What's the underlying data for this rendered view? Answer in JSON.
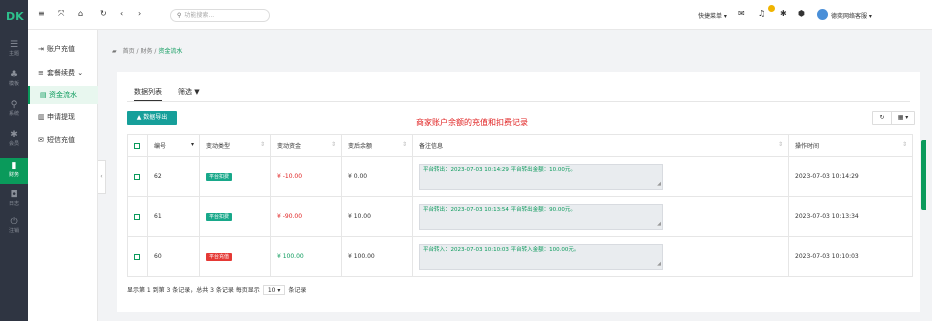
{
  "logo": "DK",
  "iconbar": [
    {
      "icon": "menu-icon",
      "glyph": "☰",
      "label": "主题"
    },
    {
      "icon": "org-icon",
      "glyph": "♣",
      "label": "模板"
    },
    {
      "icon": "location-icon",
      "glyph": "⚲",
      "label": "系统"
    },
    {
      "icon": "tag-icon",
      "glyph": "✱",
      "label": "会员"
    },
    {
      "icon": "finance-icon",
      "glyph": "▮",
      "label": "财务"
    },
    {
      "icon": "shield-icon",
      "glyph": "◘",
      "label": "日志"
    },
    {
      "icon": "power-icon",
      "glyph": "⏻",
      "label": "注销"
    }
  ],
  "submenu": [
    {
      "glyph": "⇥",
      "label": "账户充值"
    },
    {
      "glyph": "≡",
      "label": "套餐续费 ⌄"
    },
    {
      "glyph": "▤",
      "label": "资金流水"
    },
    {
      "glyph": "▥",
      "label": "申请提现"
    },
    {
      "glyph": "✉",
      "label": "短信充值"
    }
  ],
  "topbar": {
    "search_placeholder": "功能搜索...",
    "quick_menu": "快捷菜单 ▾",
    "user_name": "德奕网络客服 ▾",
    "notify_count": ""
  },
  "breadcrumb": {
    "home": "首页",
    "sep1": " / ",
    "section": "财务",
    "sep2": " / ",
    "current": "资金流水"
  },
  "tabs": {
    "list": "数据列表",
    "filter": "筛选 ▼"
  },
  "toolbar": {
    "export": "▲ 数据导出",
    "refresh": "↻",
    "columns": "▦ ▾"
  },
  "note_text": "商家账户余额的充值和扣费记录",
  "table": {
    "headers": [
      "编号",
      "变动类型",
      "变动资金",
      "变后余额",
      "备注信息",
      "操作时间"
    ],
    "rows": [
      {
        "id": "62",
        "type": "平台扣费",
        "type_color": "#18a88a",
        "amount": "¥ -10.00",
        "amount_class": "neg",
        "balance": "¥ 0.00",
        "remark": "平台转出：2023-07-03 10:14:29 平台转出金额：10.00元。",
        "time": "2023-07-03 10:14:29"
      },
      {
        "id": "61",
        "type": "平台扣费",
        "type_color": "#18a88a",
        "amount": "¥ -90.00",
        "amount_class": "neg",
        "balance": "¥ 10.00",
        "remark": "平台转出：2023-07-03 10:13:54 平台转出金额：90.00元。",
        "time": "2023-07-03 10:13:34"
      },
      {
        "id": "60",
        "type": "平台充值",
        "type_color": "#e53935",
        "amount": "¥ 100.00",
        "amount_class": "pos",
        "balance": "¥ 100.00",
        "remark": "平台转入：2023-07-03 10:10:03 平台转入金额：100.00元。",
        "time": "2023-07-03 10:10:03"
      }
    ]
  },
  "footer": {
    "summary": "显示第 1 到第 3 条记录，总共 3 条记录  每页显示",
    "page_size": "10 ▾",
    "suffix": "条记录"
  },
  "colors": {
    "accent": "#0a9a5b",
    "danger": "#e02020",
    "sidebar": "#2f3542"
  }
}
